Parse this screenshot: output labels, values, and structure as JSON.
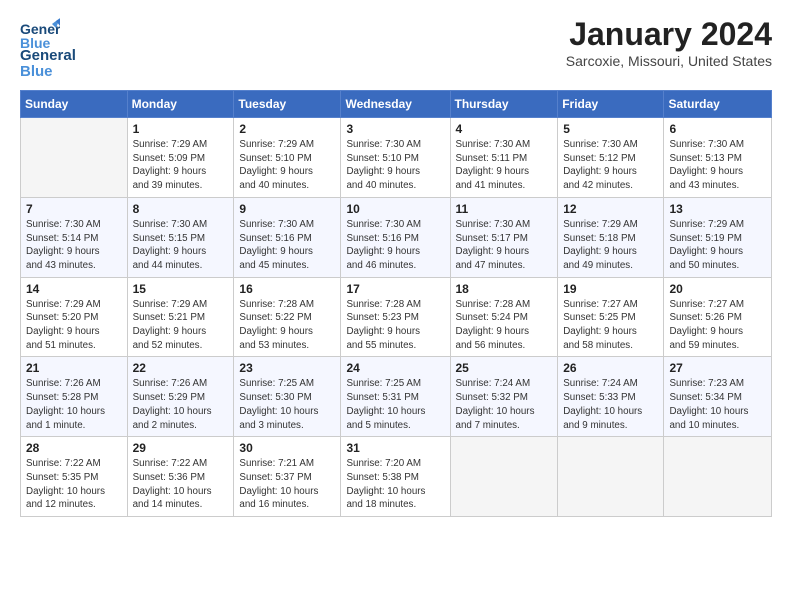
{
  "header": {
    "logo_line1": "General",
    "logo_line2": "Blue",
    "month_title": "January 2024",
    "location": "Sarcoxie, Missouri, United States"
  },
  "days_of_week": [
    "Sunday",
    "Monday",
    "Tuesday",
    "Wednesday",
    "Thursday",
    "Friday",
    "Saturday"
  ],
  "weeks": [
    [
      {
        "day": "",
        "info": ""
      },
      {
        "day": "1",
        "info": "Sunrise: 7:29 AM\nSunset: 5:09 PM\nDaylight: 9 hours\nand 39 minutes."
      },
      {
        "day": "2",
        "info": "Sunrise: 7:29 AM\nSunset: 5:10 PM\nDaylight: 9 hours\nand 40 minutes."
      },
      {
        "day": "3",
        "info": "Sunrise: 7:30 AM\nSunset: 5:10 PM\nDaylight: 9 hours\nand 40 minutes."
      },
      {
        "day": "4",
        "info": "Sunrise: 7:30 AM\nSunset: 5:11 PM\nDaylight: 9 hours\nand 41 minutes."
      },
      {
        "day": "5",
        "info": "Sunrise: 7:30 AM\nSunset: 5:12 PM\nDaylight: 9 hours\nand 42 minutes."
      },
      {
        "day": "6",
        "info": "Sunrise: 7:30 AM\nSunset: 5:13 PM\nDaylight: 9 hours\nand 43 minutes."
      }
    ],
    [
      {
        "day": "7",
        "info": "Sunrise: 7:30 AM\nSunset: 5:14 PM\nDaylight: 9 hours\nand 43 minutes."
      },
      {
        "day": "8",
        "info": "Sunrise: 7:30 AM\nSunset: 5:15 PM\nDaylight: 9 hours\nand 44 minutes."
      },
      {
        "day": "9",
        "info": "Sunrise: 7:30 AM\nSunset: 5:16 PM\nDaylight: 9 hours\nand 45 minutes."
      },
      {
        "day": "10",
        "info": "Sunrise: 7:30 AM\nSunset: 5:16 PM\nDaylight: 9 hours\nand 46 minutes."
      },
      {
        "day": "11",
        "info": "Sunrise: 7:30 AM\nSunset: 5:17 PM\nDaylight: 9 hours\nand 47 minutes."
      },
      {
        "day": "12",
        "info": "Sunrise: 7:29 AM\nSunset: 5:18 PM\nDaylight: 9 hours\nand 49 minutes."
      },
      {
        "day": "13",
        "info": "Sunrise: 7:29 AM\nSunset: 5:19 PM\nDaylight: 9 hours\nand 50 minutes."
      }
    ],
    [
      {
        "day": "14",
        "info": "Sunrise: 7:29 AM\nSunset: 5:20 PM\nDaylight: 9 hours\nand 51 minutes."
      },
      {
        "day": "15",
        "info": "Sunrise: 7:29 AM\nSunset: 5:21 PM\nDaylight: 9 hours\nand 52 minutes."
      },
      {
        "day": "16",
        "info": "Sunrise: 7:28 AM\nSunset: 5:22 PM\nDaylight: 9 hours\nand 53 minutes."
      },
      {
        "day": "17",
        "info": "Sunrise: 7:28 AM\nSunset: 5:23 PM\nDaylight: 9 hours\nand 55 minutes."
      },
      {
        "day": "18",
        "info": "Sunrise: 7:28 AM\nSunset: 5:24 PM\nDaylight: 9 hours\nand 56 minutes."
      },
      {
        "day": "19",
        "info": "Sunrise: 7:27 AM\nSunset: 5:25 PM\nDaylight: 9 hours\nand 58 minutes."
      },
      {
        "day": "20",
        "info": "Sunrise: 7:27 AM\nSunset: 5:26 PM\nDaylight: 9 hours\nand 59 minutes."
      }
    ],
    [
      {
        "day": "21",
        "info": "Sunrise: 7:26 AM\nSunset: 5:28 PM\nDaylight: 10 hours\nand 1 minute."
      },
      {
        "day": "22",
        "info": "Sunrise: 7:26 AM\nSunset: 5:29 PM\nDaylight: 10 hours\nand 2 minutes."
      },
      {
        "day": "23",
        "info": "Sunrise: 7:25 AM\nSunset: 5:30 PM\nDaylight: 10 hours\nand 3 minutes."
      },
      {
        "day": "24",
        "info": "Sunrise: 7:25 AM\nSunset: 5:31 PM\nDaylight: 10 hours\nand 5 minutes."
      },
      {
        "day": "25",
        "info": "Sunrise: 7:24 AM\nSunset: 5:32 PM\nDaylight: 10 hours\nand 7 minutes."
      },
      {
        "day": "26",
        "info": "Sunrise: 7:24 AM\nSunset: 5:33 PM\nDaylight: 10 hours\nand 9 minutes."
      },
      {
        "day": "27",
        "info": "Sunrise: 7:23 AM\nSunset: 5:34 PM\nDaylight: 10 hours\nand 10 minutes."
      }
    ],
    [
      {
        "day": "28",
        "info": "Sunrise: 7:22 AM\nSunset: 5:35 PM\nDaylight: 10 hours\nand 12 minutes."
      },
      {
        "day": "29",
        "info": "Sunrise: 7:22 AM\nSunset: 5:36 PM\nDaylight: 10 hours\nand 14 minutes."
      },
      {
        "day": "30",
        "info": "Sunrise: 7:21 AM\nSunset: 5:37 PM\nDaylight: 10 hours\nand 16 minutes."
      },
      {
        "day": "31",
        "info": "Sunrise: 7:20 AM\nSunset: 5:38 PM\nDaylight: 10 hours\nand 18 minutes."
      },
      {
        "day": "",
        "info": ""
      },
      {
        "day": "",
        "info": ""
      },
      {
        "day": "",
        "info": ""
      }
    ]
  ]
}
